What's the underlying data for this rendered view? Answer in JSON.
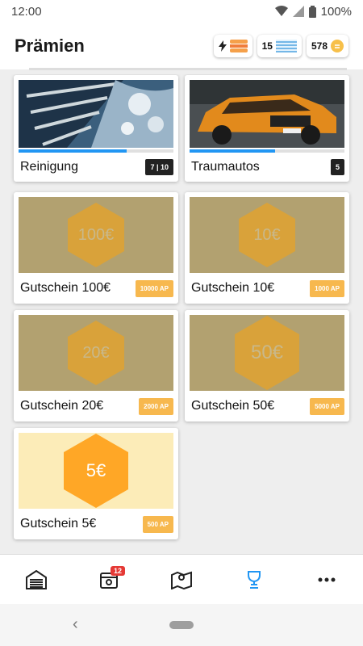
{
  "status_bar": {
    "time": "12:00",
    "battery": "100%"
  },
  "header": {
    "title": "Prämien",
    "counters": [
      {
        "icon": "lightning-icon",
        "value": ""
      },
      {
        "icon": "water-icon",
        "value": "15"
      },
      {
        "icon": "coin-icon",
        "value": "578"
      }
    ]
  },
  "cards": [
    {
      "title": "Reinigung",
      "badge": "7 | 10",
      "progress": 0.7
    },
    {
      "title": "Traumautos",
      "badge": "5",
      "progress": 0.55
    }
  ],
  "vouchers": [
    {
      "amount": "100€",
      "title": "Gutschein 100€",
      "cost": "10000 AP",
      "active": false
    },
    {
      "amount": "10€",
      "title": "Gutschein 10€",
      "cost": "1000 AP",
      "active": false
    },
    {
      "amount": "20€",
      "title": "Gutschein 20€",
      "cost": "2000 AP",
      "active": false
    },
    {
      "amount": "50€",
      "title": "Gutschein 50€",
      "cost": "5000 AP",
      "active": false
    },
    {
      "amount": "5€",
      "title": "Gutschein 5€",
      "cost": "500 AP",
      "active": true
    }
  ],
  "bottom_nav": [
    {
      "icon": "garage-icon",
      "label": ""
    },
    {
      "icon": "calendar-icon",
      "label": "",
      "badge": "12"
    },
    {
      "icon": "map-icon",
      "label": ""
    },
    {
      "icon": "trophy-icon",
      "label": "",
      "active": true
    },
    {
      "icon": "more-icon",
      "label": ""
    }
  ],
  "colors": {
    "accent": "#2196f3",
    "badge_ap": "#f7b84e",
    "hex_active": "#ffa726",
    "voucher_locked": "#b2a170"
  }
}
